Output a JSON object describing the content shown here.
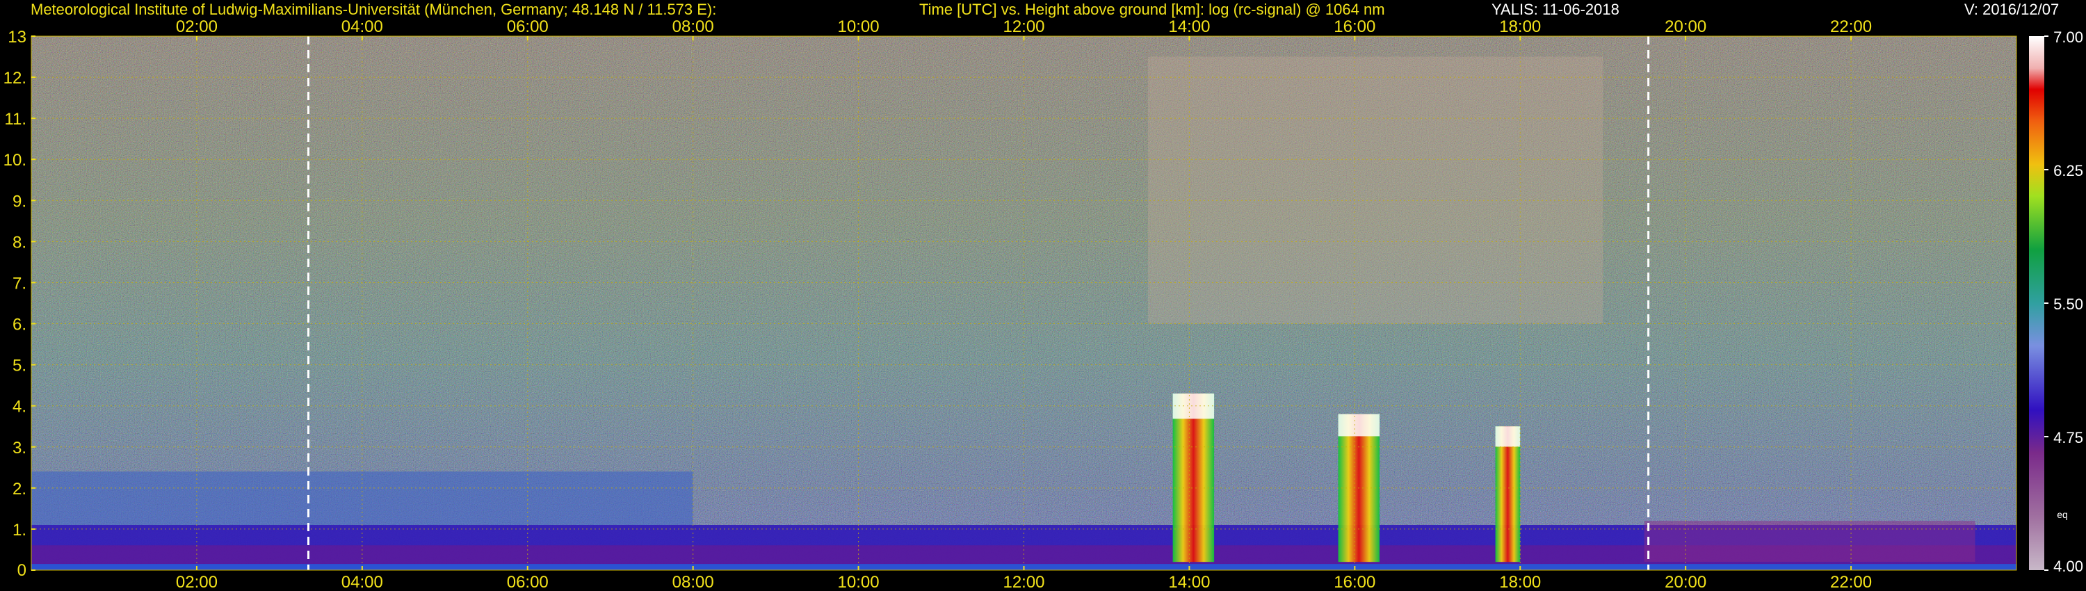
{
  "header": {
    "institute": "Meteorological Institute of Ludwig-Maximilians-Universität (München, Germany; 48.148 N / 11.573 E):",
    "subject": "Time [UTC] vs. Height above ground [km]: log (rc-signal) @ 1064 nm",
    "station_date": "YALIS: 11-06-2018",
    "version": "V: 2016/12/07"
  },
  "colors": {
    "background": "#000000",
    "header_yellow": "#f2e21a",
    "header_white": "#ffffff",
    "tick_label_yellow": "#f2e21a",
    "axis_label_white": "#ffffff",
    "grid_yellow": "#c8b000"
  },
  "chart_data": {
    "type": "heatmap",
    "title": "Time [UTC] vs. Height above ground [km]: log (rc-signal) @ 1064 nm",
    "xlabel": "",
    "ylabel": "",
    "x_unit": "hour UTC",
    "x_range": [
      0,
      24
    ],
    "x_ticks": [
      2,
      4,
      6,
      8,
      10,
      12,
      14,
      16,
      18,
      20,
      22
    ],
    "x_tick_labels": [
      "02:00",
      "04:00",
      "06:00",
      "08:00",
      "10:00",
      "12:00",
      "14:00",
      "16:00",
      "18:00",
      "20:00",
      "22:00"
    ],
    "y_range": [
      0,
      13
    ],
    "y_ticks": [
      0,
      1,
      2,
      3,
      4,
      5,
      6,
      7,
      8,
      9,
      10,
      11,
      12,
      13
    ],
    "y_tick_labels": [
      "0",
      "1.",
      "2.",
      "3.",
      "4.",
      "5.",
      "6.",
      "7.",
      "8.",
      "9.",
      "10.",
      "11.",
      "12.",
      "13"
    ],
    "grid": true,
    "dashed_markers_hour": [
      3.35,
      19.55
    ],
    "colorbar": {
      "range": [
        4.0,
        7.0
      ],
      "ticks": [
        4.0,
        4.75,
        5.5,
        6.25,
        7.0
      ],
      "tick_labels": [
        "4.00",
        "4.75",
        "5.50",
        "6.25",
        "7.00"
      ],
      "small_label": "eq"
    },
    "features": [
      {
        "kind": "boundary_layer",
        "hour_start": 0,
        "hour_end": 24,
        "height_top_km": 1.1
      },
      {
        "kind": "residual_layer",
        "hour_start": 0,
        "hour_end": 8,
        "height_top_km": 2.4
      },
      {
        "kind": "cloud_column",
        "hour_start": 13.8,
        "hour_end": 14.3,
        "height_base_km": 0.2,
        "height_top_km": 4.3
      },
      {
        "kind": "cloud_column",
        "hour_start": 15.8,
        "hour_end": 16.3,
        "height_base_km": 0.2,
        "height_top_km": 3.8
      },
      {
        "kind": "cloud_column",
        "hour_start": 17.7,
        "hour_end": 18.0,
        "height_base_km": 0.2,
        "height_top_km": 3.5
      },
      {
        "kind": "cirrus",
        "hour_start": 13.5,
        "hour_end": 19.0,
        "height_base_km": 6.0,
        "height_top_km": 12.5
      },
      {
        "kind": "aerosol_layer",
        "hour_start": 19.5,
        "hour_end": 23.5,
        "height_base_km": 0.2,
        "height_top_km": 1.2
      }
    ]
  }
}
